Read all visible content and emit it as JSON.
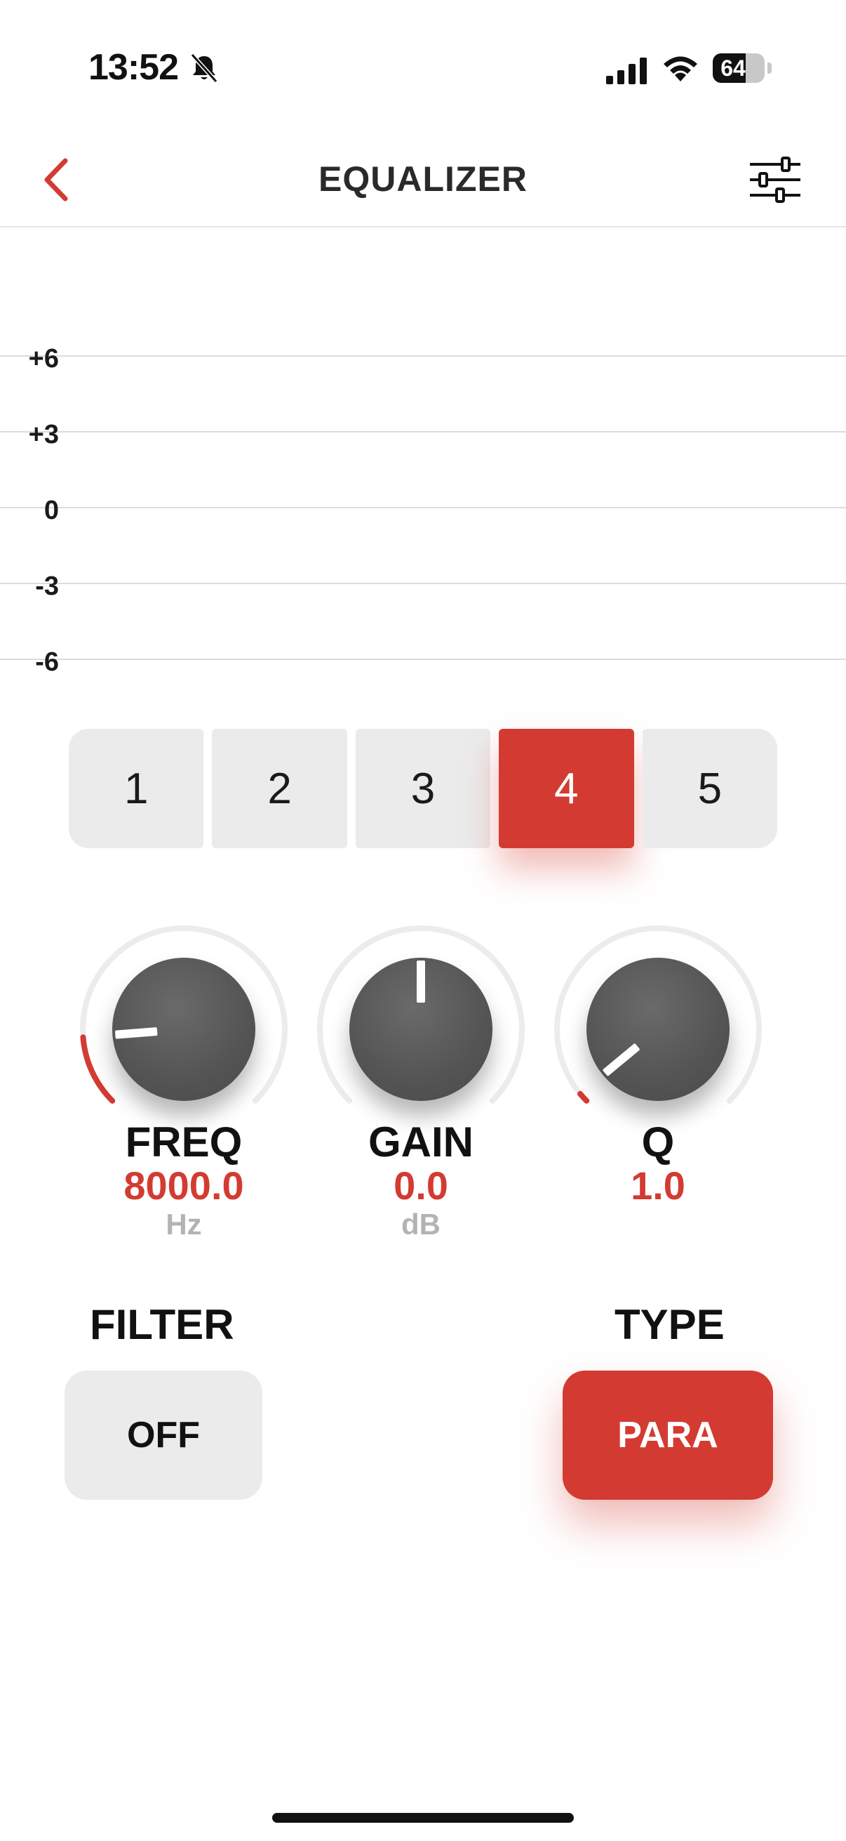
{
  "status_bar": {
    "time": "13:52",
    "battery_level": "64",
    "battery_fraction": 0.64,
    "icons": [
      "bell-slash-icon",
      "cellular-signal-icon",
      "wifi-icon",
      "battery-icon"
    ]
  },
  "nav": {
    "title": "EQUALIZER",
    "back_icon": "chevron-left-icon",
    "settings_icon": "sliders-icon"
  },
  "graph": {
    "levels": [
      "+6",
      "+3",
      "0",
      "-3",
      "-6"
    ]
  },
  "bands": {
    "items": [
      "1",
      "2",
      "3",
      "4",
      "5"
    ],
    "selected": "4"
  },
  "knobs": {
    "freq": {
      "label": "FREQ",
      "value": "8000.0",
      "unit": "Hz",
      "level_fraction": 0.15
    },
    "gain": {
      "label": "GAIN",
      "value": "0.0",
      "unit": "dB",
      "level_fraction": 0.5
    },
    "q": {
      "label": "Q",
      "value": "1.0",
      "unit": "",
      "level_fraction": 0.02
    }
  },
  "filter": {
    "label": "FILTER",
    "value": "OFF"
  },
  "type": {
    "label": "TYPE",
    "value": "PARA"
  },
  "colors": {
    "accent": "#d33b32",
    "knob": "#555555",
    "inactive_button": "#ebebeb",
    "muted_text": "#b3b3b3"
  }
}
